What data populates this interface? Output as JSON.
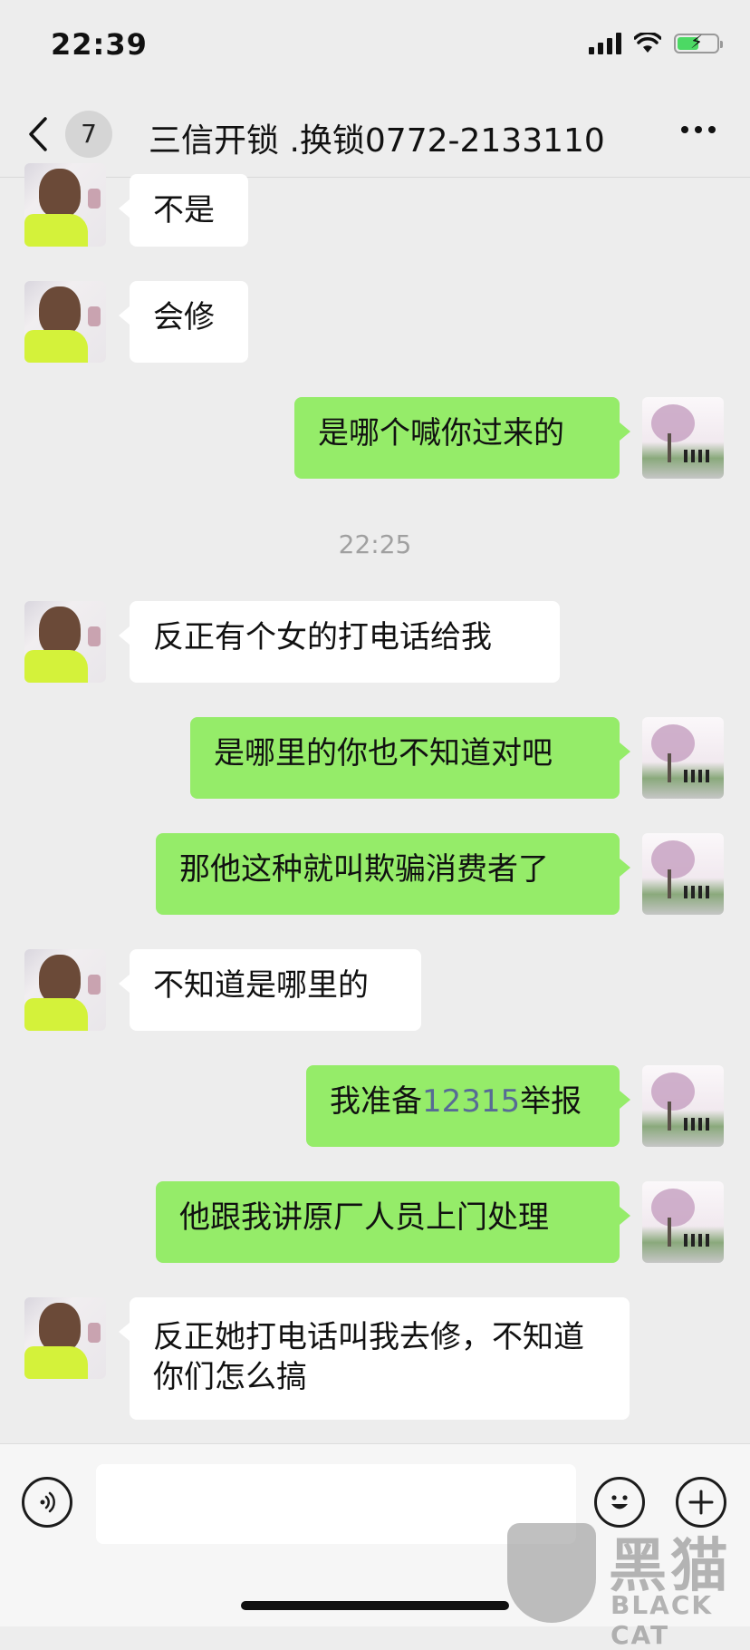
{
  "status_bar": {
    "time": "22:39",
    "battery_level": 0.55,
    "battery_color": "#4cd964",
    "icons": [
      "cellular-signal-icon",
      "wifi-icon",
      "battery-charging-icon"
    ]
  },
  "nav": {
    "back_icon": "chevron-left-icon",
    "unread_count": "7",
    "title": "三信开锁 .换锁0772-2133110",
    "more_icon": "more-dots-icon"
  },
  "messages": [
    {
      "side": "left",
      "text": "不是"
    },
    {
      "side": "left",
      "text": "会修"
    },
    {
      "side": "right",
      "text": "是哪个喊你过来的"
    },
    {
      "side": "left",
      "text": "反正有个女的打电话给我"
    },
    {
      "side": "right",
      "text": "是哪里的你也不知道对吧"
    },
    {
      "side": "right",
      "text": "那他这种就叫欺骗消费者了"
    },
    {
      "side": "left",
      "text": "不知道是哪里的"
    },
    {
      "side": "right",
      "text_before": "我准备",
      "link": "12315",
      "text_after": "举报"
    },
    {
      "side": "right",
      "text": "他跟我讲原厂人员上门处理"
    },
    {
      "side": "left",
      "text": "反正她打电话叫我去修，不知道你们怎么搞"
    }
  ],
  "timestamp": "22:25",
  "input_bar": {
    "voice_icon": "voice-input-icon",
    "emoji_icon": "emoji-icon",
    "plus_icon": "plus-icon",
    "input_value": ""
  },
  "watermark": {
    "chinese": "黑猫",
    "english": "BLACK CAT"
  },
  "colors": {
    "sent_bubble": "#95ec69",
    "received_bubble": "#ffffff",
    "background": "#ededed",
    "link": "#576b95"
  }
}
